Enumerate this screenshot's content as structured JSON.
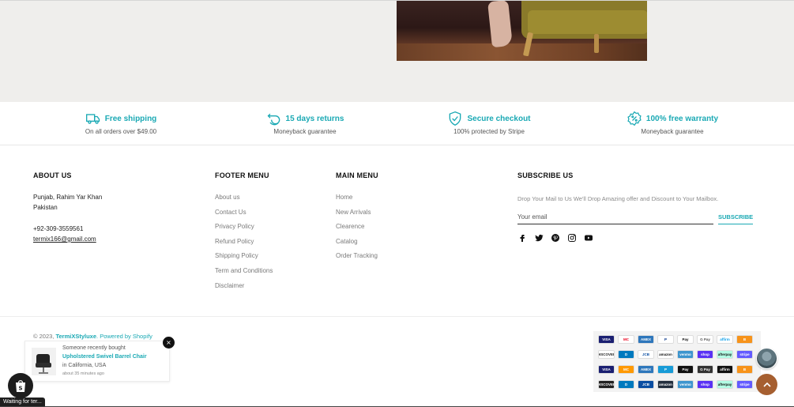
{
  "features": [
    {
      "title": "Free shipping",
      "subtitle": "On all orders over $49.00",
      "icon": "truck-icon"
    },
    {
      "title": "15 days returns",
      "subtitle": "Moneyback guarantee",
      "icon": "return-icon"
    },
    {
      "title": "Secure checkout",
      "subtitle": "100% protected by Stripe",
      "icon": "shield-check-icon"
    },
    {
      "title": "100% free warranty",
      "subtitle": "Moneyback guarantee",
      "icon": "percent-badge-icon"
    }
  ],
  "about": {
    "title": "ABOUT US",
    "address_line1": "Punjab, Rahim Yar Khan",
    "address_line2": "Pakistan",
    "phone": "+92-309-3559561",
    "email": "termix166@gmail.com"
  },
  "footer_menu": {
    "title": "FOOTER MENU",
    "items": [
      "About us",
      "Contact Us",
      "Privacy Policy",
      "Refund Policy",
      "Shipping Policy",
      "Term and Conditions",
      "Disclaimer"
    ]
  },
  "main_menu": {
    "title": "MAIN MENU",
    "items": [
      "Home",
      "New Arrivals",
      "Clearence",
      "Catalog",
      "Order Tracking"
    ]
  },
  "subscribe": {
    "title": "SUBSCRIBE US",
    "text": "Drop Your Mail to Us We'll Drop Amazing offer and Discount to Your Mailbox.",
    "placeholder": "Your email",
    "button": "SUBSCRIBE",
    "social_icons": [
      "facebook-icon",
      "twitter-icon",
      "pinterest-icon",
      "instagram-icon",
      "youtube-icon"
    ]
  },
  "copyright": {
    "prefix": "© 2023, ",
    "brand": "TermiXStyluxe",
    "powered": ". Powered by Shopify"
  },
  "payments": {
    "row1": [
      "VISA",
      "MC",
      "AMEX",
      "P",
      "Pay",
      "G Pay",
      "affirm",
      "B"
    ],
    "row2": [
      "DISCOVER",
      "D",
      "JCB",
      "amazon",
      "venmo",
      "shop",
      "afterpay",
      "stripe"
    ],
    "row3": [
      "VISA",
      "MC",
      "AMEX",
      "P",
      "Pay",
      "G Pay",
      "affirm",
      "B"
    ],
    "row4": [
      "DISCOVER",
      "D",
      "JCB",
      "amazon",
      "venmo",
      "shop",
      "afterpay",
      "stripe"
    ]
  },
  "notification": {
    "line1": "Someone recently bought",
    "product": "Upholstered Swivel Barrel Chair",
    "location": "in California, USA",
    "time": "about 35 minutes ago",
    "close": "×"
  },
  "status_bar": "Waiting for ter...",
  "colors": {
    "accent": "#1aa9b4",
    "scroll_button": "#a65f30",
    "hero_bg": "#efeeec"
  }
}
